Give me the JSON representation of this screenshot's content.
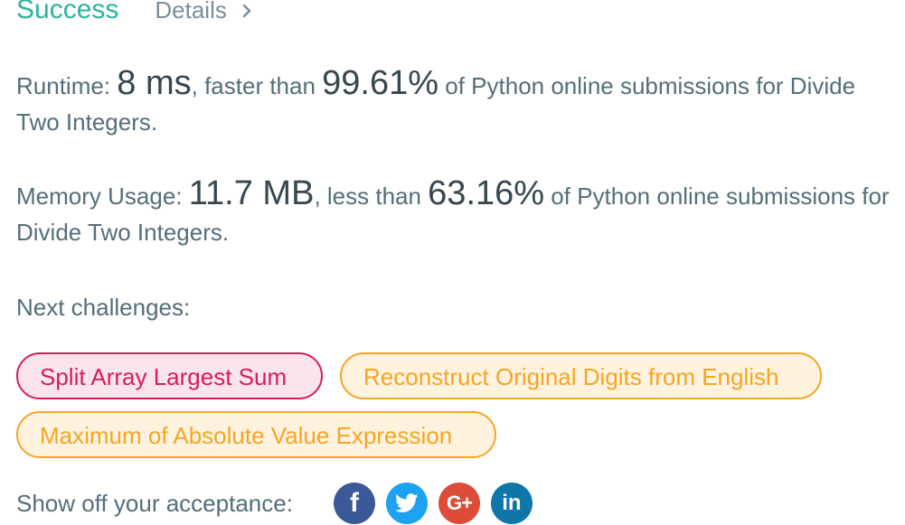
{
  "status": {
    "label": "Success",
    "details_label": "Details",
    "success_color": "#2db3a0"
  },
  "runtime": {
    "label": "Runtime: ",
    "value": "8 ms",
    "comparison": ", faster than ",
    "percent": "99.61%",
    "suffix": " of Python online submissions for Divide Two Integers."
  },
  "memory": {
    "label": "Memory Usage: ",
    "value": "11.7 MB",
    "comparison": ", less than ",
    "percent": "63.16%",
    "suffix": " of Python online submissions for Divide Two Integers."
  },
  "next_challenges": {
    "label": "Next challenges:",
    "items": [
      {
        "title": "Split Array Largest Sum",
        "difficulty_color": "#d81b60"
      },
      {
        "title": "Reconstruct Original Digits from English",
        "difficulty_color": "#f5a623"
      },
      {
        "title": "Maximum of Absolute Value Expression",
        "difficulty_color": "#f5a623"
      }
    ]
  },
  "share": {
    "label": "Show off your acceptance:",
    "buttons": [
      {
        "icon": "facebook-icon",
        "glyph": "f",
        "color": "#3b5998"
      },
      {
        "icon": "twitter-icon",
        "glyph": "",
        "color": "#1da1f2"
      },
      {
        "icon": "google-plus-icon",
        "glyph": "G+",
        "color": "#dd4b39"
      },
      {
        "icon": "linkedin-icon",
        "glyph": "in",
        "color": "#0e76a8"
      }
    ]
  }
}
